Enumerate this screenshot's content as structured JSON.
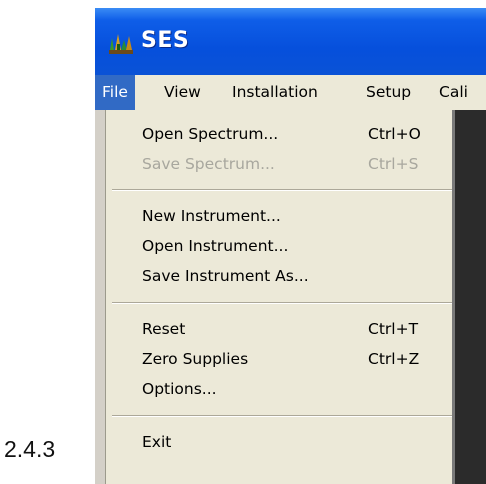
{
  "section_number": "2.4.3",
  "window": {
    "title": "SES",
    "app_icon": "ses-app-icon"
  },
  "menubar": {
    "items": [
      "File",
      "View",
      "Installation",
      "Setup",
      "Cali"
    ],
    "active": "File"
  },
  "file_menu": {
    "items": [
      {
        "label": "Open Spectrum...",
        "shortcut": "Ctrl+O",
        "enabled": true
      },
      {
        "label": "Save Spectrum...",
        "shortcut": "Ctrl+S",
        "enabled": false
      },
      {
        "label": "New Instrument...",
        "shortcut": "",
        "enabled": true
      },
      {
        "label": "Open Instrument...",
        "shortcut": "",
        "enabled": true
      },
      {
        "label": "Save Instrument As...",
        "shortcut": "",
        "enabled": true
      },
      {
        "label": "Reset",
        "shortcut": "Ctrl+T",
        "enabled": true
      },
      {
        "label": "Zero Supplies",
        "shortcut": "Ctrl+Z",
        "enabled": true
      },
      {
        "label": "Options...",
        "shortcut": "",
        "enabled": true
      },
      {
        "label": "Exit",
        "shortcut": "",
        "enabled": true
      }
    ]
  },
  "colors": {
    "titlebar": "#0650dc",
    "menu_highlight": "#316ac5",
    "menu_background": "#ece9d8",
    "disabled_text": "#a8a79e"
  }
}
